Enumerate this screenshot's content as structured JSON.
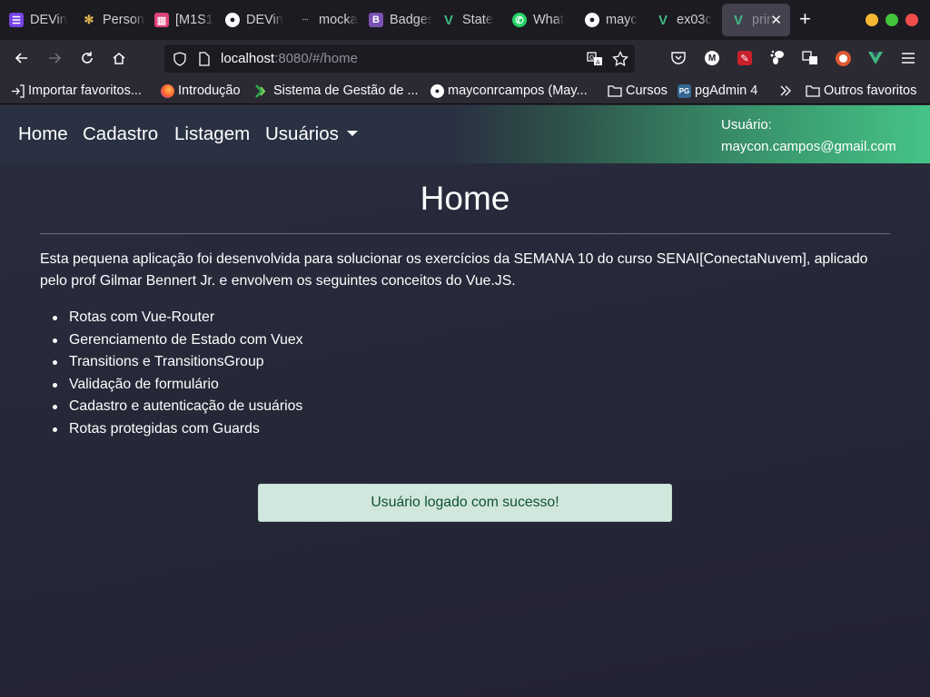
{
  "browser": {
    "tabs": [
      {
        "title": "DEVin",
        "icon": "list-icon",
        "color": "#7542e5"
      },
      {
        "title": "Personal",
        "icon": "atom-icon",
        "color": "#3c3c46"
      },
      {
        "title": "[M1S1",
        "icon": "board-icon",
        "color": "#e0427a"
      },
      {
        "title": "DEVin",
        "icon": "github-icon",
        "color": "#fbfbfe"
      },
      {
        "title": "mocka",
        "icon": "api-icon",
        "color": "#8f8f9d"
      },
      {
        "title": "Badges",
        "icon": "bootstrap-icon",
        "color": "#7952b3"
      },
      {
        "title": "State",
        "icon": "vue-icon",
        "color": "#41b883"
      },
      {
        "title": "What",
        "icon": "whatsapp-icon",
        "color": "#25d366"
      },
      {
        "title": "mayc",
        "icon": "github-icon",
        "color": "#fbfbfe"
      },
      {
        "title": "ex03c",
        "icon": "vue-icon",
        "color": "#41b883"
      },
      {
        "title": "prin",
        "icon": "vue-icon",
        "color": "#41b883",
        "active": true
      }
    ],
    "url": {
      "host": "localhost",
      "rest": ":8080/#/home"
    },
    "bookmarks": [
      {
        "label": "Importar favoritos...",
        "icon": "import-icon"
      },
      {
        "label": "Introdução",
        "icon": "firefox-icon"
      },
      {
        "label": "Sistema de Gestão de ...",
        "icon": "chevrons-icon"
      },
      {
        "label": "mayconrcampos (May...",
        "icon": "github-icon"
      },
      {
        "label": "Cursos",
        "icon": "folder-icon"
      },
      {
        "label": "pgAdmin 4",
        "icon": "pgadmin-icon"
      },
      {
        "label": "Outros favoritos",
        "icon": "folder-icon"
      }
    ],
    "window_buttons": {
      "minimize": "#f5b833",
      "maximize": "#43c43b",
      "close": "#f04c4c"
    }
  },
  "app": {
    "nav": {
      "home": "Home",
      "cadastro": "Cadastro",
      "listagem": "Listagem",
      "usuarios": "Usuários"
    },
    "user": {
      "label": "Usuário:",
      "email": "maycon.campos@gmail.com"
    },
    "title": "Home",
    "intro": "Esta pequena aplicação foi desenvolvida para solucionar os exercícios da SEMANA 10 do curso SENAI[ConectaNuvem], aplicado pelo prof Gilmar Bennert Jr. e envolvem os seguintes conceitos do Vue.JS.",
    "features": [
      "Rotas com Vue-Router",
      "Gerenciamento de Estado com Vuex",
      "Transitions e TransitionsGroup",
      "Validação de formulário",
      "Cadastro e autenticação de usuários",
      "Rotas protegidas com Guards"
    ],
    "alert": "Usuário logado com sucesso!"
  }
}
